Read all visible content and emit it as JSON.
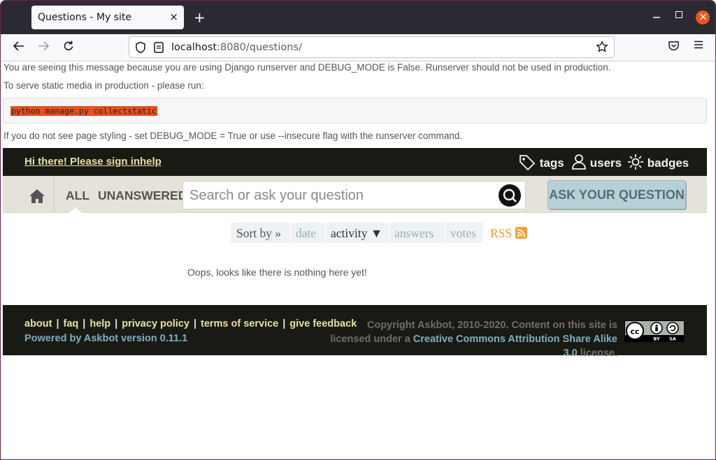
{
  "browser": {
    "tab_title": "Questions - My site",
    "tab_close": "×",
    "new_tab": "+",
    "url_host": "localhost",
    "url_rest": ":8080/questions/"
  },
  "debug": {
    "line1": "You are seeing this message because you are using Django runserver and DEBUG_MODE is False. Runserver should not be used in production.",
    "line2": "To serve static media in production - please run:",
    "command": "python manage.py collectstatic",
    "line3": "If you do not see page styling - set DEBUG_MODE = True or use --insecure flag with the runserver command."
  },
  "header": {
    "signin": "Hi there! Please sign in",
    "help": "help",
    "nav": {
      "tags": "tags",
      "users": "users",
      "badges": "badges"
    }
  },
  "scope": {
    "all": "ALL",
    "unanswered": "UNANSWERED"
  },
  "search": {
    "placeholder": "Search or ask your question",
    "ask_button": "ASK YOUR QUESTION"
  },
  "sort": {
    "label": "Sort by »",
    "date": "date",
    "activity": "activity ▼",
    "answers": "answers",
    "votes": "votes",
    "rss": "RSS"
  },
  "main": {
    "empty_message": "Oops, looks like there is nothing here yet!"
  },
  "footer": {
    "links": [
      "about",
      "faq",
      "help",
      "privacy policy",
      "terms of service",
      "give feedback"
    ],
    "separator": "|",
    "powered": "Powered by Askbot version 0.11.1",
    "copyright_pre": "Copyright Askbot, 2010-2020. Content on this site is licensed under a",
    "license_link": "Creative Commons Attribution Share Alike 3.0",
    "copyright_post": "license.",
    "badge_cc": "cc",
    "badge_by": "BY",
    "badge_sa": "SA"
  },
  "colors": {
    "header_bg": "#1a1a14",
    "link_yellow": "#e3e0a4",
    "link_blue": "#7faebf",
    "ask_button_bg": "#b9cfd6",
    "code_highlight": "#e55020"
  }
}
